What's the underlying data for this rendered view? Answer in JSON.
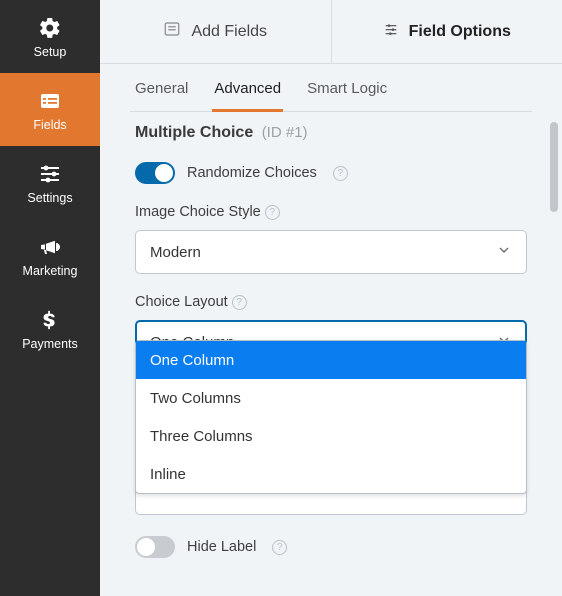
{
  "sidebar": {
    "items": [
      {
        "label": "Setup"
      },
      {
        "label": "Fields"
      },
      {
        "label": "Settings"
      },
      {
        "label": "Marketing"
      },
      {
        "label": "Payments"
      }
    ]
  },
  "topTabs": {
    "addFields": "Add Fields",
    "fieldOptions": "Field Options"
  },
  "subTabs": {
    "general": "General",
    "advanced": "Advanced",
    "smartLogic": "Smart Logic"
  },
  "heading": {
    "title": "Multiple Choice",
    "id": "(ID #1)"
  },
  "randomize": {
    "label": "Randomize Choices"
  },
  "imageChoice": {
    "label": "Image Choice Style",
    "value": "Modern"
  },
  "choiceLayout": {
    "label": "Choice Layout",
    "value": "One Column",
    "options": [
      "One Column",
      "Two Columns",
      "Three Columns",
      "Inline"
    ]
  },
  "hideLabel": {
    "label": "Hide Label"
  }
}
